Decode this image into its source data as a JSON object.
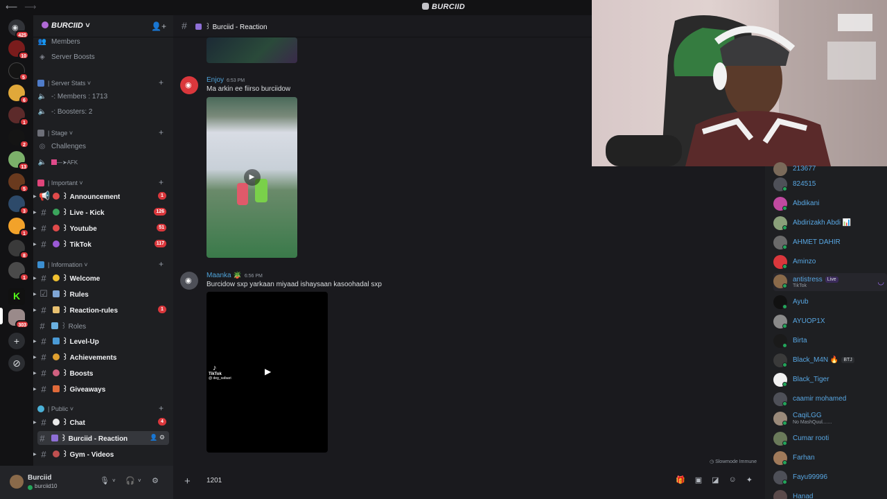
{
  "window": {
    "title": "BURCIID"
  },
  "rail": {
    "badges": [
      "425",
      "10",
      "5",
      "6",
      "1",
      "2",
      "13",
      "5",
      "3",
      "1",
      "8",
      "1",
      "303"
    ]
  },
  "server": {
    "name": "BURCIID"
  },
  "sidebar": {
    "top_items": [
      {
        "label": "Members"
      },
      {
        "label": "Server Boosts"
      }
    ],
    "cat_stats": "| Server Stats",
    "stats": [
      {
        "label": "-: Members : 1713"
      },
      {
        "label": "-: Boosters: 2"
      }
    ],
    "cat_stage": "| Stage",
    "stage_items": [
      {
        "label": "Challenges"
      },
      {
        "label": "—➤AFK"
      }
    ],
    "cat_important": "| Important",
    "important": [
      {
        "label": "꒱ Announcement",
        "badge": "1"
      },
      {
        "label": "꒱ Live - Kick",
        "badge": "126"
      },
      {
        "label": "꒱ Youtube",
        "badge": "51"
      },
      {
        "label": "꒱ TikTok",
        "badge": "117"
      }
    ],
    "cat_information": "| Information",
    "information": [
      {
        "label": "꒱ Welcome",
        "badge": ""
      },
      {
        "label": "꒱ Rules",
        "badge": ""
      },
      {
        "label": "꒱ Reaction-rules",
        "badge": "1"
      },
      {
        "label": "꒱ Roles",
        "badge": ""
      },
      {
        "label": "꒱ Level-Up",
        "badge": ""
      },
      {
        "label": "꒱ Achievements",
        "badge": ""
      },
      {
        "label": "꒱ Boosts",
        "badge": ""
      },
      {
        "label": "꒱ Giveaways",
        "badge": ""
      }
    ],
    "cat_public": "| Public",
    "public": [
      {
        "label": "꒱ Chat",
        "badge": "4"
      },
      {
        "label": "꒱ Burciid - Reaction",
        "badge": ""
      },
      {
        "label": "꒱ Gym - Videos",
        "badge": ""
      }
    ]
  },
  "user": {
    "name": "Burciid",
    "tag": "burciid10"
  },
  "channel": {
    "name": "꒱ Burciid - Reaction"
  },
  "messages": [
    {
      "author": "Enjoy",
      "time": "6:53 PM",
      "text": "Ma arkin  ee fiirso burciidow"
    },
    {
      "author": "Maanka 🪴",
      "time": "6:56 PM",
      "text": "Burcidow sxp yarkaan miyaad ishaysaan kasoohadal sxp"
    }
  ],
  "tiktok": {
    "label": "TikTok",
    "handle": "@ deg_safaari"
  },
  "slowmode": "Slowmode Immune",
  "composer": {
    "value": "1201"
  },
  "members": [
    {
      "name": "213677",
      "sub": "",
      "tag": ""
    },
    {
      "name": "824515",
      "sub": "",
      "tag": ""
    },
    {
      "name": "Abdikani",
      "sub": "",
      "tag": ""
    },
    {
      "name": "Abdirizakh Abdi 📊",
      "sub": "",
      "tag": ""
    },
    {
      "name": "AHMET DAHIR",
      "sub": "",
      "tag": ""
    },
    {
      "name": "Aminzo",
      "sub": "",
      "tag": ""
    },
    {
      "name": "antistress",
      "sub": "TikTok",
      "tag": "Live"
    },
    {
      "name": "Ayub",
      "sub": "",
      "tag": ""
    },
    {
      "name": "AYUOP1X",
      "sub": "",
      "tag": ""
    },
    {
      "name": "Birta",
      "sub": "",
      "tag": ""
    },
    {
      "name": "Black_M4N 🔥",
      "sub": "",
      "tag": "BTJ"
    },
    {
      "name": "Black_Tiger",
      "sub": "",
      "tag": ""
    },
    {
      "name": "caamir mohamed",
      "sub": "",
      "tag": ""
    },
    {
      "name": "CaqiLGG",
      "sub": "No MashQuul.......",
      "tag": ""
    },
    {
      "name": "Cumar rooti",
      "sub": "",
      "tag": ""
    },
    {
      "name": "Farhan",
      "sub": "",
      "tag": ""
    },
    {
      "name": "Fayu99996",
      "sub": "",
      "tag": ""
    },
    {
      "name": "Hanad",
      "sub": "",
      "tag": ""
    }
  ],
  "colors": {
    "accent": "#5865f2",
    "badge": "#da373c",
    "online": "#23a55a",
    "link": "#58a7e3"
  }
}
